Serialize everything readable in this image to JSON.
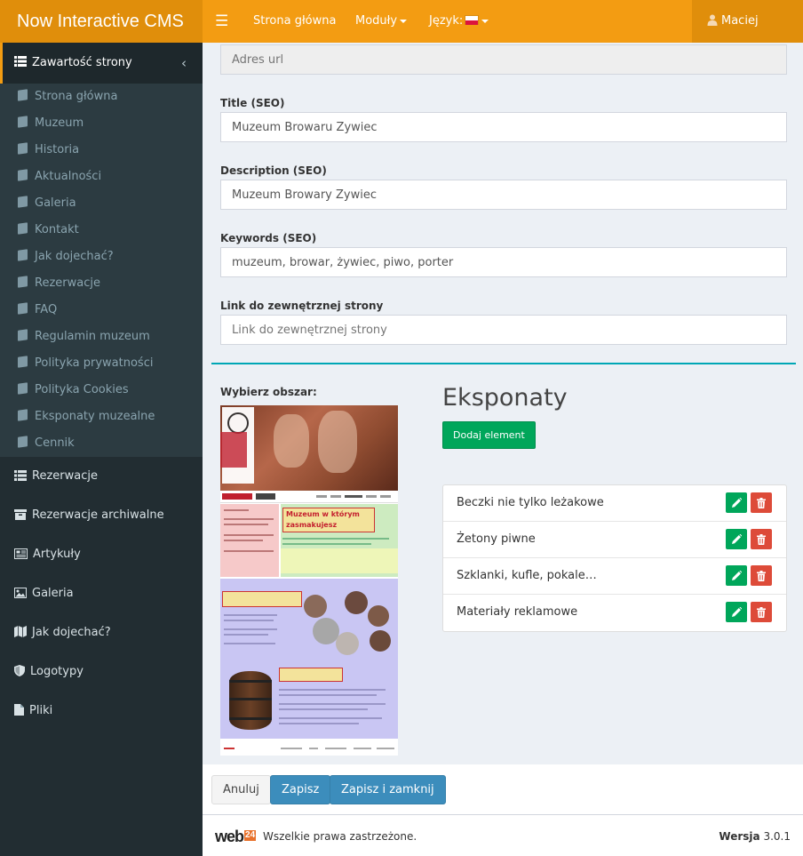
{
  "app": {
    "title": "Now Interactive CMS"
  },
  "navbar": {
    "menu_icon": "hamburger-icon",
    "home": "Strona główna",
    "modules": "Moduły",
    "language": "Język:",
    "flag": "poland-flag-icon",
    "user": "Maciej",
    "colors": {
      "primary": "#f39c12",
      "dark": "#e08e0b"
    }
  },
  "sidebar": {
    "section": "Zawartość strony",
    "sub_items": [
      "Strona główna",
      "Muzeum",
      "Historia",
      "Aktualności",
      "Galeria",
      "Kontakt",
      "Jak dojechać?",
      "Rezerwacje",
      "FAQ",
      "Regulamin muzeum",
      "Polityka prywatności",
      "Polityka Cookies",
      "Eksponaty muzealne",
      "Cennik"
    ],
    "items": [
      {
        "label": "Rezerwacje",
        "icon": "list-icon"
      },
      {
        "label": "Rezerwacje archiwalne",
        "icon": "archive-icon"
      },
      {
        "label": "Artykuły",
        "icon": "newspaper-icon"
      },
      {
        "label": "Galeria",
        "icon": "image-icon"
      },
      {
        "label": "Jak dojechać?",
        "icon": "map-icon"
      },
      {
        "label": "Logotypy",
        "icon": "shield-icon"
      },
      {
        "label": "Pliki",
        "icon": "file-icon"
      }
    ]
  },
  "form": {
    "url_placeholder": "Adres url",
    "title_label": "Title (SEO)",
    "title_value": "Muzeum Browaru Żywiec",
    "description_label": "Description (SEO)",
    "description_value": "Muzeum Browary Żywiec",
    "keywords_label": "Keywords (SEO)",
    "keywords_value": "muzeum, browar, żywiec, piwo, porter",
    "link_label": "Link do zewnętrznej strony",
    "link_placeholder": "Link do zewnętrznej strony"
  },
  "area": {
    "label": "Wybierz obszar:",
    "preview_headline": "Muzeum w którym zasmakujesz"
  },
  "exhibits": {
    "title": "Eksponaty",
    "add_button": "Dodaj element",
    "items": [
      "Beczki nie tylko leżakowe",
      "Żetony piwne",
      "Szklanki, kufle, pokale…",
      "Materiały reklamowe"
    ]
  },
  "actions": {
    "cancel": "Anuluj",
    "save": "Zapisz",
    "save_close": "Zapisz i zamknij"
  },
  "footer": {
    "brand": "web",
    "brand_badge": "24",
    "rights": "Wszelkie prawa zastrzeżone.",
    "version_label": "Wersja",
    "version": "3.0.1"
  }
}
